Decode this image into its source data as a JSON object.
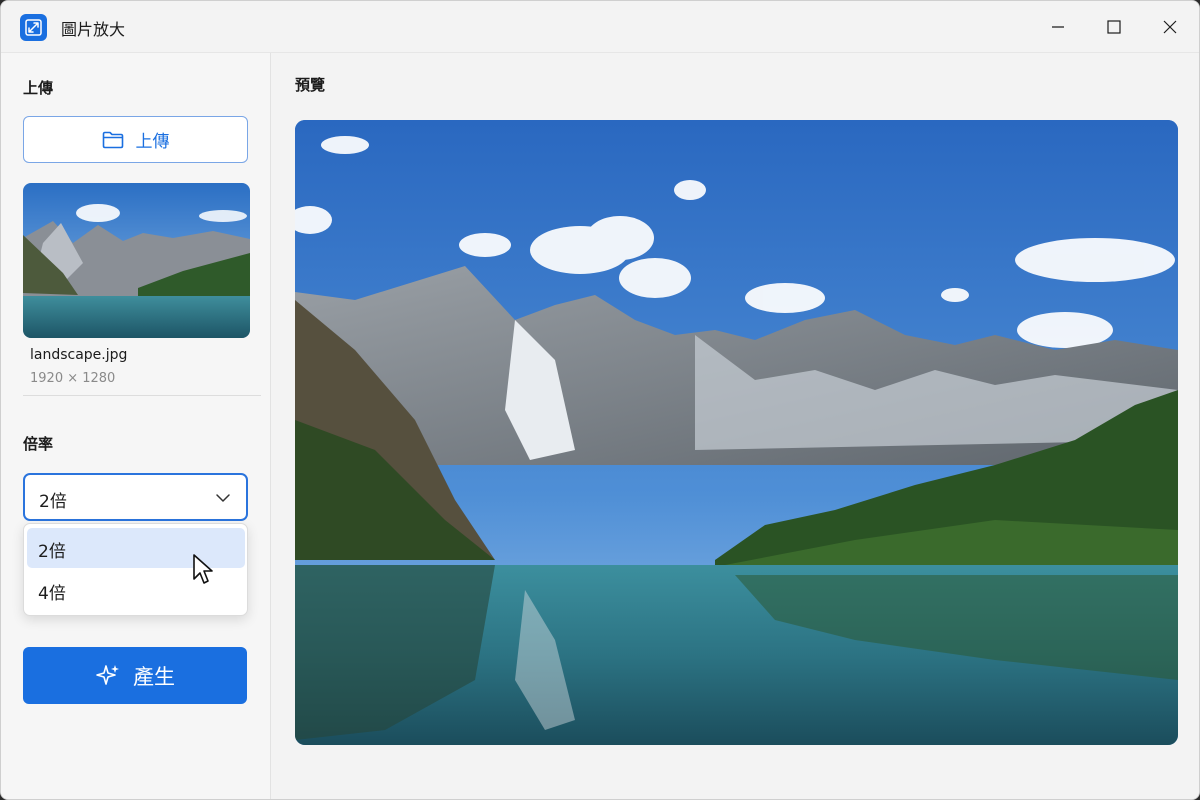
{
  "window": {
    "title": "圖片放大",
    "icon": "expand-icon"
  },
  "sidebar": {
    "upload_section_label": "上傳",
    "upload_button_label": "上傳",
    "upload_button_icon": "folder-icon",
    "file": {
      "name": "landscape.jpg",
      "dimensions": "1920 × 1280"
    },
    "scale_section_label": "倍率",
    "scale_select": {
      "value": "2倍",
      "options": [
        "2倍",
        "4倍"
      ],
      "highlighted_option": "2倍"
    },
    "generate_button_label": "產生",
    "generate_button_icon": "sparkle-icon"
  },
  "main": {
    "preview_label": "預覽"
  },
  "colors": {
    "accent": "#1a6fe0",
    "selected_option_bg": "#dce8fb",
    "window_bg": "#f3f3f3"
  }
}
